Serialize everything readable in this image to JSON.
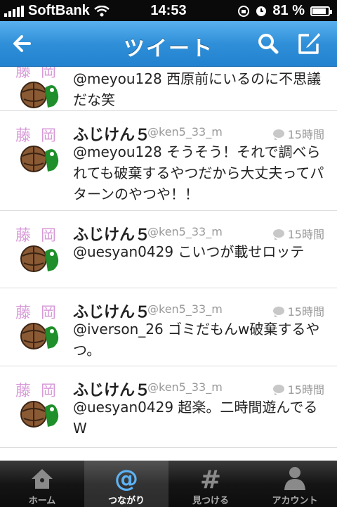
{
  "status": {
    "carrier": "SoftBank",
    "time": "14:53",
    "battery": "81 %"
  },
  "nav": {
    "title": "ツイート"
  },
  "tweets": [
    {
      "name": "",
      "handle": "",
      "time": "",
      "text": "@meyou128 西原前にいるのに不思議だな笑"
    },
    {
      "name": "ふじけん５",
      "handle": "@ken5_33_m",
      "time": "15時間",
      "text": "@meyou128 そうそう！それで調べられても破棄するやつだから大丈夫ってパターンのやつや！！"
    },
    {
      "name": "ふじけん５",
      "handle": "@ken5_33_m",
      "time": "15時間",
      "text": "@uesyan0429 こいつが載せロッテ"
    },
    {
      "name": "ふじけん５",
      "handle": "@ken5_33_m",
      "time": "15時間",
      "text": "@iverson_26 ゴミだもんw破棄するやつ。"
    },
    {
      "name": "ふじけん５",
      "handle": "@ken5_33_m",
      "time": "15時間",
      "text": "@uesyan0429 超楽。二時間遊んでるW"
    }
  ],
  "tabs": [
    {
      "label": "ホーム",
      "icon": "home-icon"
    },
    {
      "label": "つながり",
      "icon": "at-icon"
    },
    {
      "label": "見つける",
      "icon": "hash-icon"
    },
    {
      "label": "アカウント",
      "icon": "person-icon"
    }
  ],
  "colors": {
    "nav": "#2f8fd8",
    "tabbar": "#151515"
  }
}
